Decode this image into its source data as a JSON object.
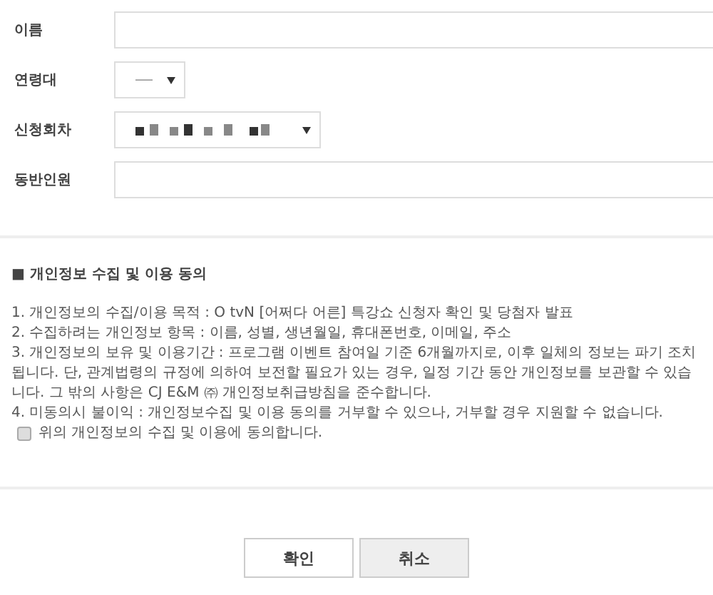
{
  "form": {
    "fields": [
      {
        "kind": "text",
        "label": "이름"
      },
      {
        "kind": "select",
        "label": "연령대"
      },
      {
        "kind": "wideselect",
        "label": "신청회차"
      },
      {
        "kind": "text",
        "label": "동반인원"
      }
    ]
  },
  "consent": {
    "heading": "■ 개인정보 수집 및 이용 동의",
    "items": [
      "1. 개인정보의 수집/이용 목적 : O tvN [어쩌다 어른] 특강쇼 신청자 확인 및 당첨자 발표",
      "2. 수집하려는 개인정보 항목 : 이름, 성별, 생년월일, 휴대폰번호, 이메일, 주소",
      "3. 개인정보의 보유 및 이용기간 : 프로그램 이벤트 참여일 기준 6개월까지로, 이후 일체의 정보는 파기 조치 됩니다. 단, 관계법령의 규정에 의하여 보전할 필요가 있는 경우, 일정 기간 동안 개인정보를 보관할 수 있습니다. 그 밖의 사항은 CJ E&M ㈜ 개인정보취급방침을 준수합니다.",
      "4. 미동의시 불이익 : 개인정보수집 및 이용 동의를 거부할 수 있으나, 거부할 경우 지원할 수 없습니다."
    ],
    "agree": {
      "label": "위의 개인정보의 수집 및 이용에 동의합니다.",
      "checked": false
    }
  },
  "buttons": [
    {
      "label": "확인",
      "kind": "primary"
    },
    {
      "label": "취소",
      "kind": "secondary"
    }
  ]
}
